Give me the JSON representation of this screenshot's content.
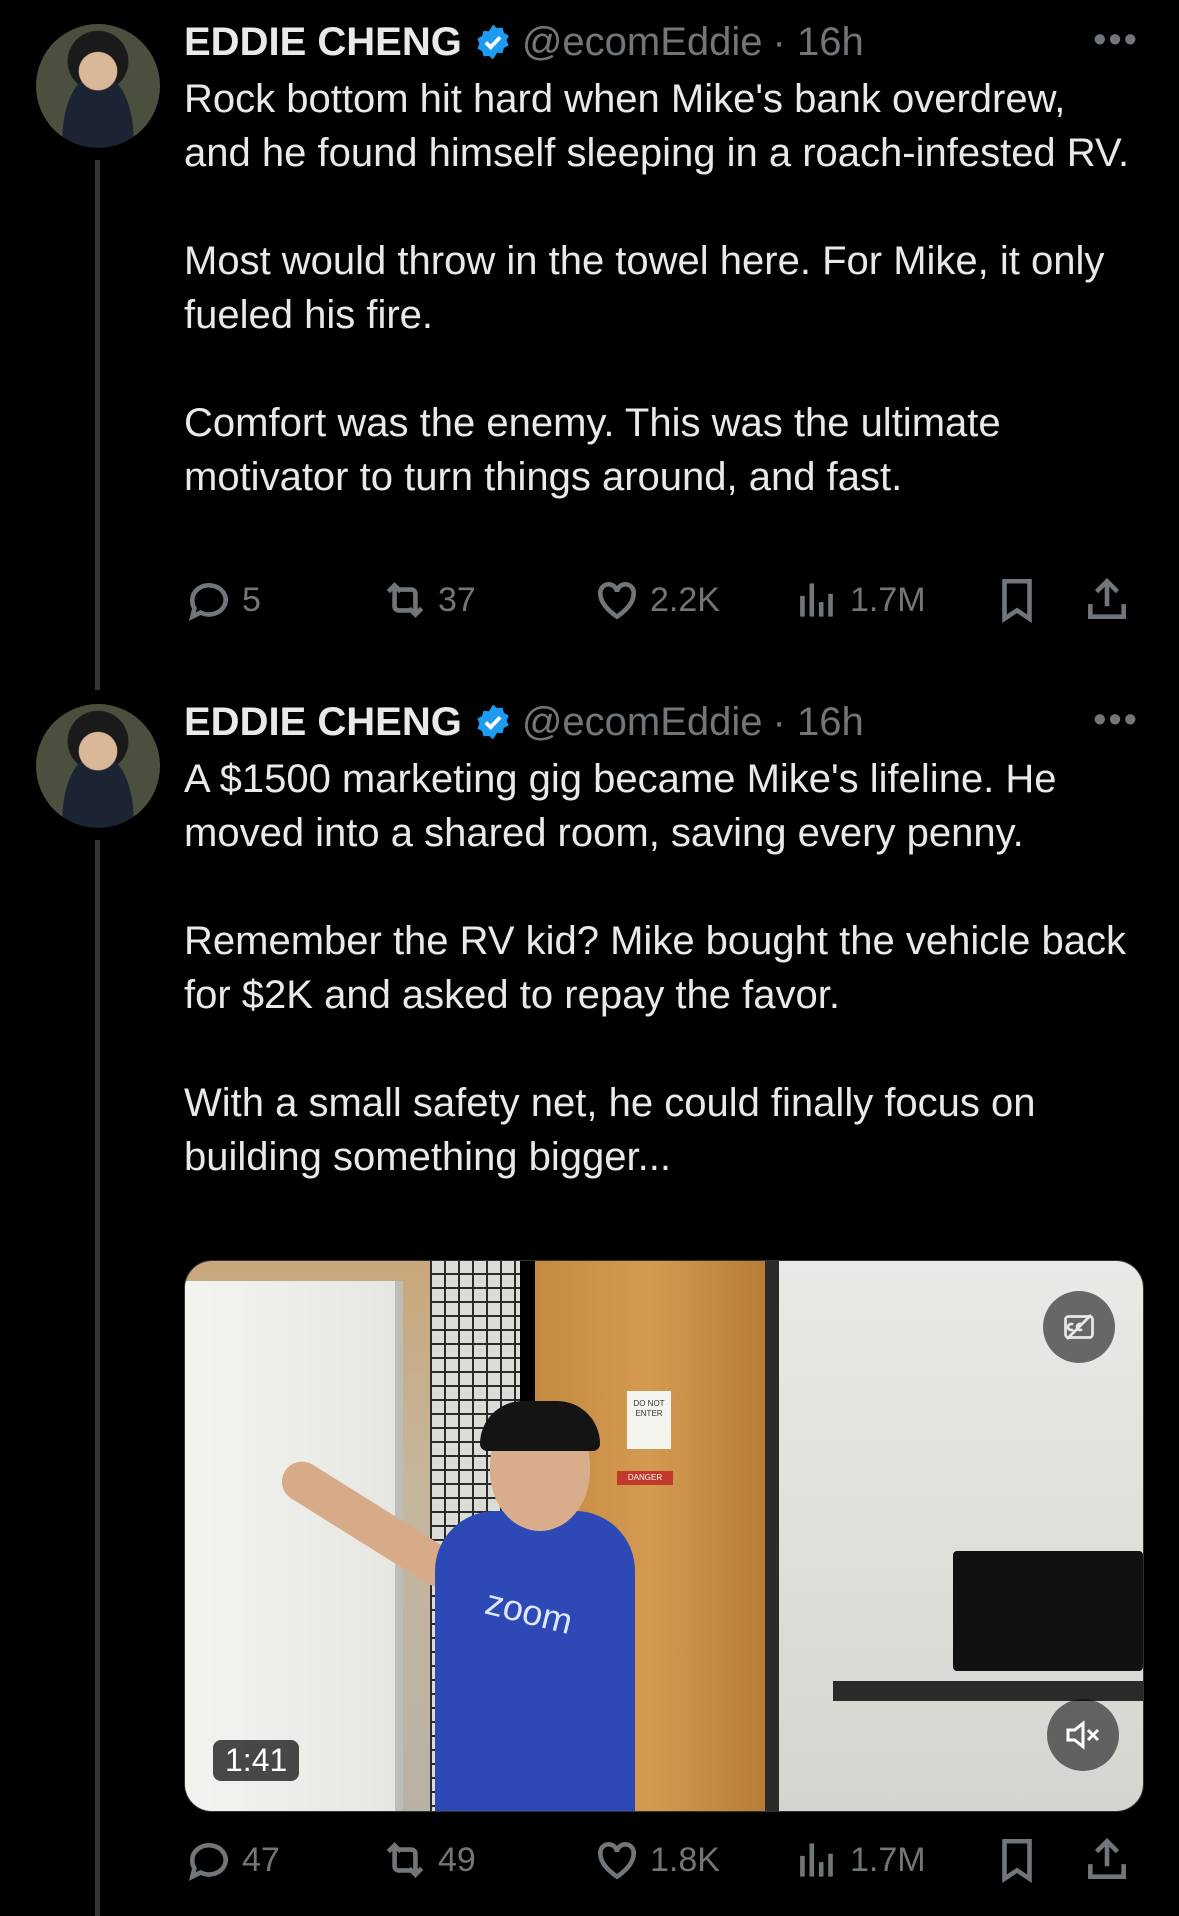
{
  "colors": {
    "background": "#000000",
    "text": "#e7e9ea",
    "muted": "#71767b",
    "verified": "#1d9bf0",
    "thread_line": "#333639"
  },
  "tweets": [
    {
      "author": {
        "name": "EDDIE CHENG",
        "handle": "@ecomEddie",
        "time": "· 16h",
        "verified_icon": "verified-badge-icon"
      },
      "paragraphs": [
        "Rock bottom hit hard when Mike's bank overdrew, and he found himself sleeping in a roach-infested RV.",
        "Most would throw in the towel here. For Mike, it only fueled his fire.",
        "Comfort was the enemy. This was the ultimate motivator to turn things around, and fast."
      ],
      "stats": {
        "replies": "5",
        "reposts": "37",
        "likes": "2.2K",
        "views": "1.7M"
      }
    },
    {
      "author": {
        "name": "EDDIE CHENG",
        "handle": "@ecomEddie",
        "time": "· 16h",
        "verified_icon": "verified-badge-icon"
      },
      "paragraphs": [
        "A $1500 marketing gig became Mike's lifeline. He moved into a shared room, saving every penny.",
        "Remember the RV kid? Mike bought the vehicle back for $2K and asked to repay the favor.",
        "With a small safety net, he could finally focus on building something bigger..."
      ],
      "media": {
        "type": "video",
        "duration": "1:41",
        "shirt_text": "zoom",
        "sign_text": "DO NOT ENTER",
        "danger_text": "DANGER"
      },
      "stats": {
        "replies": "47",
        "reposts": "49",
        "likes": "1.8K",
        "views": "1.7M"
      }
    }
  ],
  "more_label": "•••"
}
